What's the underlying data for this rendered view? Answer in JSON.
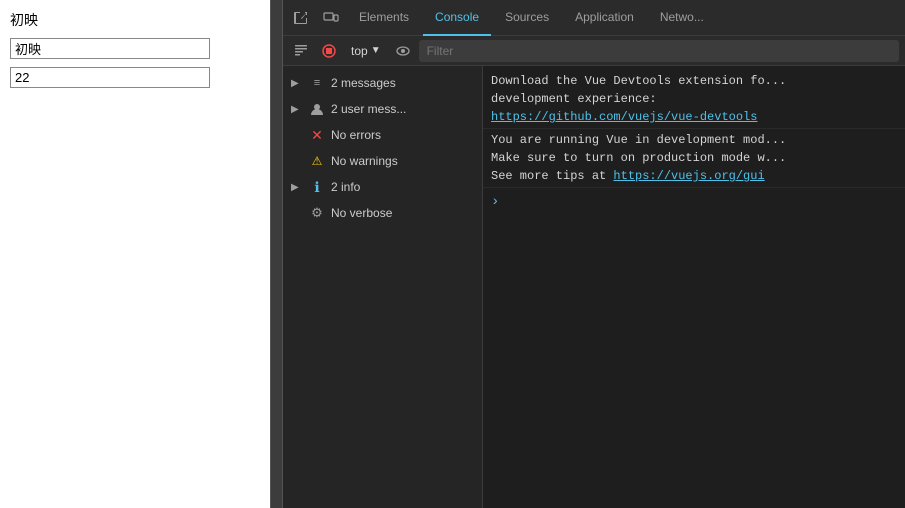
{
  "webpage": {
    "label": "初映",
    "input1_value": "初映",
    "input2_value": "22"
  },
  "devtools": {
    "tabs": [
      {
        "id": "elements",
        "label": "Elements",
        "active": false
      },
      {
        "id": "console",
        "label": "Console",
        "active": true
      },
      {
        "id": "sources",
        "label": "Sources",
        "active": false
      },
      {
        "id": "application",
        "label": "Application",
        "active": false
      },
      {
        "id": "network",
        "label": "Netwo...",
        "active": false
      }
    ],
    "toolbar": {
      "context_selector": "top",
      "filter_placeholder": "Filter"
    },
    "sidebar_items": [
      {
        "id": "messages",
        "label": "2 messages",
        "has_arrow": true,
        "icon": "list",
        "expanded": false
      },
      {
        "id": "user-messages",
        "label": "2 user mess...",
        "has_arrow": true,
        "icon": "user",
        "expanded": false
      },
      {
        "id": "errors",
        "label": "No errors",
        "has_arrow": false,
        "icon": "error"
      },
      {
        "id": "warnings",
        "label": "No warnings",
        "has_arrow": false,
        "icon": "warning"
      },
      {
        "id": "info",
        "label": "2 info",
        "has_arrow": true,
        "icon": "info",
        "expanded": false
      },
      {
        "id": "verbose",
        "label": "No verbose",
        "has_arrow": false,
        "icon": "verbose"
      }
    ],
    "console_messages": [
      {
        "id": "msg1",
        "text": "Download the Vue Devtools extension fo... development experience:",
        "link": "https://github.com/vuejs/vue-devtools"
      },
      {
        "id": "msg2",
        "text": "You are running Vue in development mod... Make sure to turn on production mode w... See more tips at",
        "link": "https://vuejs.org/gui"
      }
    ]
  }
}
